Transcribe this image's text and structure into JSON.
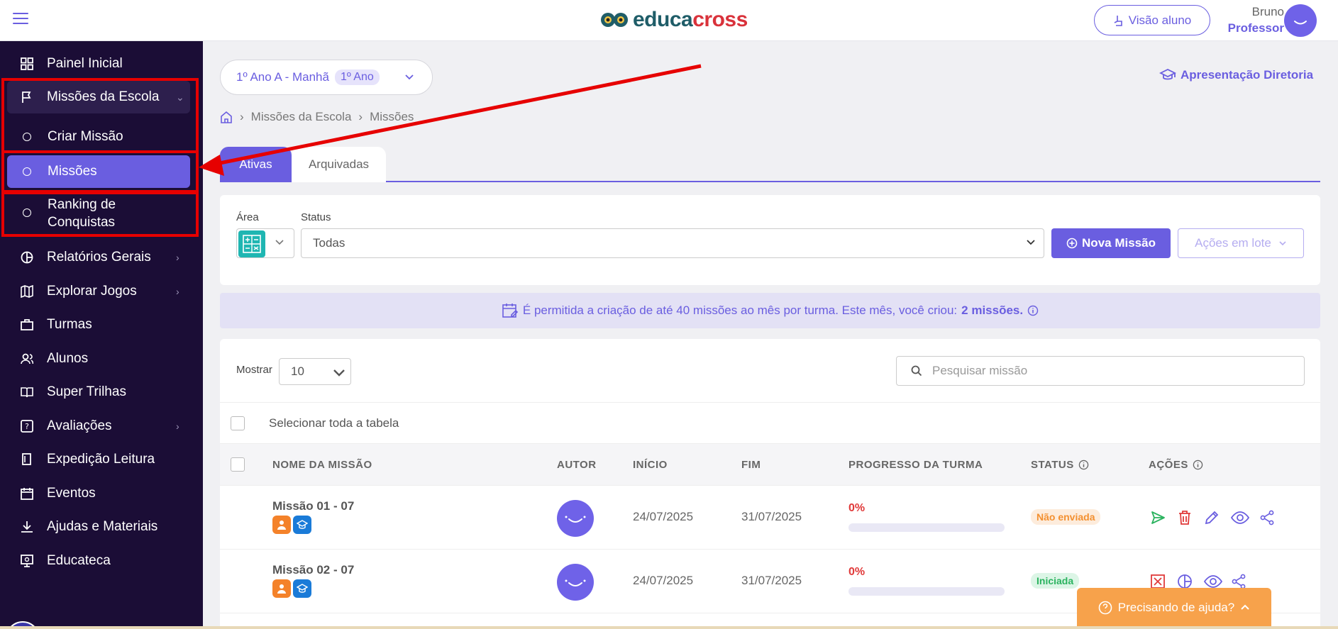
{
  "topbar": {
    "logo_part1": "educa",
    "logo_part2": "cross",
    "visao_aluno": "Visão aluno",
    "user_name": "Bruno",
    "user_role": "Professor"
  },
  "sidebar": {
    "items": [
      {
        "label": "Painel Inicial",
        "icon": "grid-icon"
      },
      {
        "label": "Missões da Escola",
        "icon": "flag-icon"
      },
      {
        "label": "Criar Missão",
        "icon": "circle-icon"
      },
      {
        "label": "Missões",
        "icon": "circle-icon"
      },
      {
        "label": "Ranking de",
        "label2": "Conquistas",
        "icon": "circle-icon"
      },
      {
        "label": "Relatórios Gerais",
        "icon": "pie-chart-icon"
      },
      {
        "label": "Explorar Jogos",
        "icon": "map-icon"
      },
      {
        "label": "Turmas",
        "icon": "briefcase-icon"
      },
      {
        "label": "Alunos",
        "icon": "users-icon"
      },
      {
        "label": "Super Trilhas",
        "icon": "book-open-icon"
      },
      {
        "label": "Avaliações",
        "icon": "quiz-icon"
      },
      {
        "label": "Expedição Leitura",
        "icon": "books-icon"
      },
      {
        "label": "Eventos",
        "icon": "calendar-icon"
      },
      {
        "label": "Ajudas e Materiais",
        "icon": "download-icon"
      },
      {
        "label": "Educateca",
        "icon": "monitor-icon"
      }
    ]
  },
  "class_selector": {
    "label": "1º Ano A - Manhã",
    "pill": "1º Ano"
  },
  "apresentacao": "Apresentação Diretoria",
  "breadcrumb": [
    "Missões da Escola",
    "Missões"
  ],
  "tabs": [
    "Ativas",
    "Arquivadas"
  ],
  "filters": {
    "area_label": "Área",
    "status_label": "Status",
    "status_value": "Todas",
    "nova_missao": "Nova Missão",
    "acoes_lote": "Ações em lote"
  },
  "info_banner": {
    "text": "É permitida a criação de até 40 missões ao mês por turma. Este mês, você criou:",
    "count": "2 missões."
  },
  "table": {
    "mostrar_label": "Mostrar",
    "mostrar_value": "10",
    "search_placeholder": "Pesquisar missão",
    "select_all": "Selecionar toda a tabela",
    "headers": [
      "NOME DA MISSÃO",
      "AUTOR",
      "INÍCIO",
      "FIM",
      "PROGRESSO DA TURMA",
      "STATUS",
      "AÇÕES"
    ],
    "rows": [
      {
        "name": "Missão 01 - 07",
        "inicio": "24/07/2025",
        "fim": "31/07/2025",
        "progress_label": "0%",
        "progress": 0,
        "status": "Não enviada"
      },
      {
        "name": "Missão 02 - 07",
        "inicio": "24/07/2025",
        "fim": "31/07/2025",
        "progress_label": "0%",
        "progress": 0,
        "status": "Iniciada"
      }
    ]
  },
  "help": "Precisando de ajuda?",
  "colors": {
    "accent": "#6a5ee0",
    "sidebar": "#1b0d36",
    "highlight": "#e60000"
  }
}
